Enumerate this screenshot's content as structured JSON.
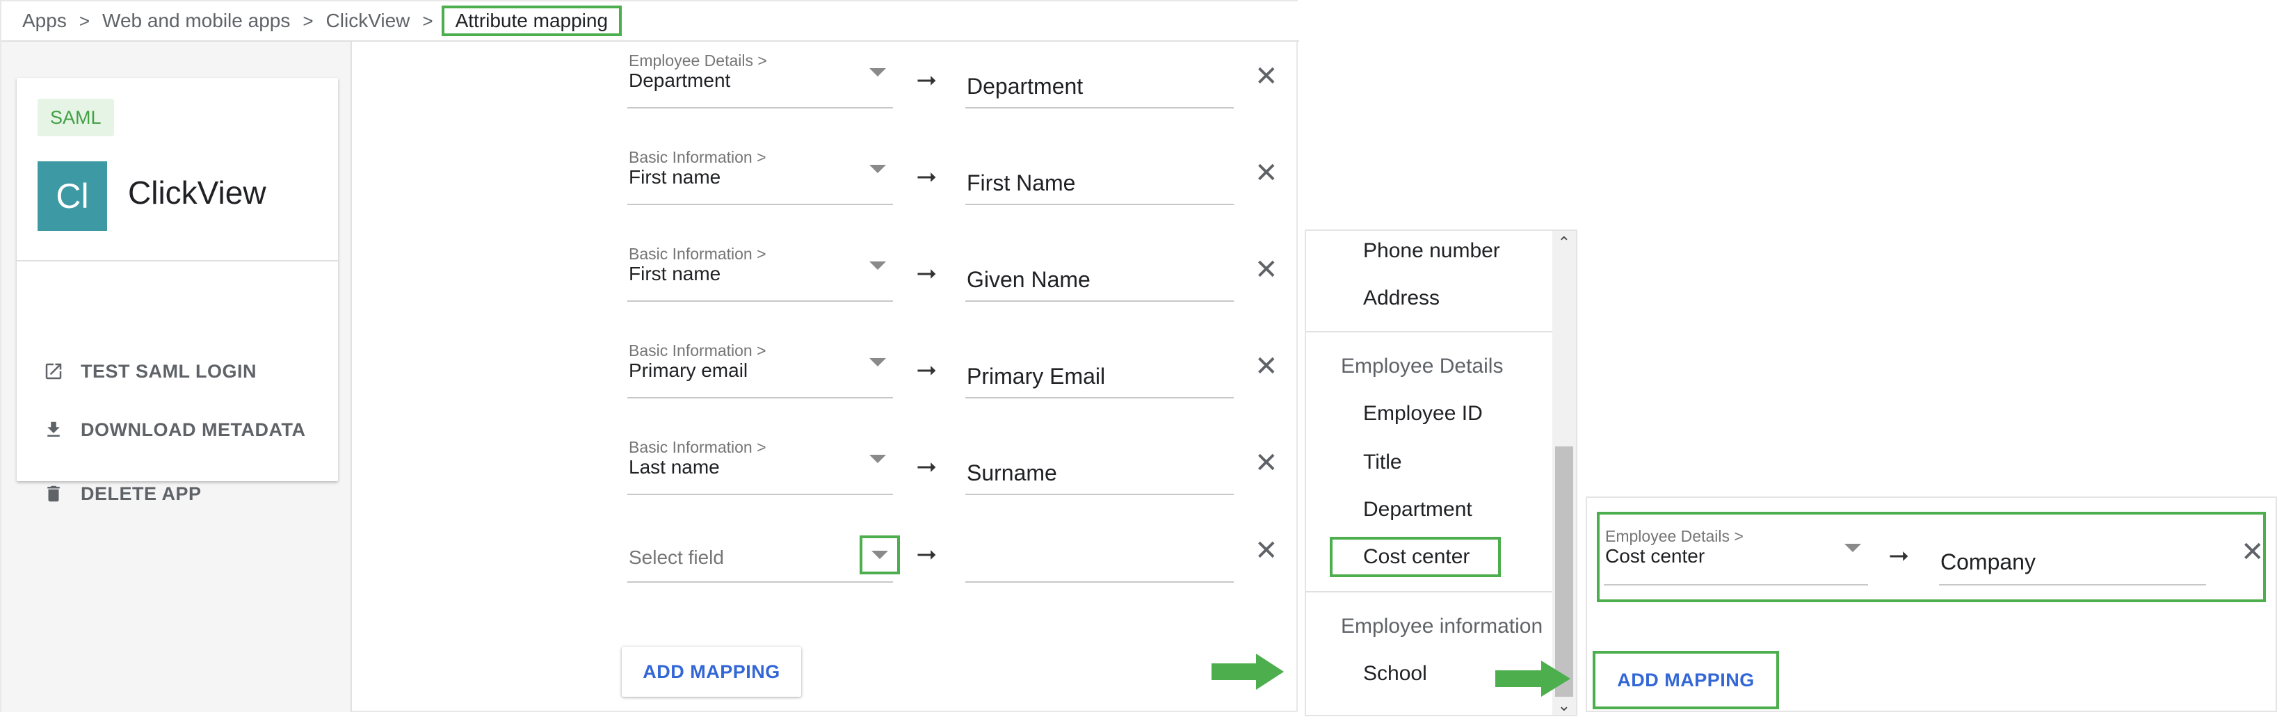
{
  "breadcrumb": {
    "items": [
      "Apps",
      "Web and mobile apps",
      "ClickView"
    ],
    "current": "Attribute mapping",
    "separator": ">"
  },
  "app_card": {
    "badge": "SAML",
    "avatar_initials": "Cl",
    "app_name": "ClickView",
    "actions": [
      {
        "label": "TEST SAML LOGIN",
        "icon": "open-external-icon"
      },
      {
        "label": "DOWNLOAD METADATA",
        "icon": "download-icon"
      },
      {
        "label": "DELETE APP",
        "icon": "trash-icon"
      }
    ]
  },
  "mappings": [
    {
      "category": "Employee Details >",
      "field": "Department",
      "target": "Department"
    },
    {
      "category": "Basic Information >",
      "field": "First name",
      "target": "First Name"
    },
    {
      "category": "Basic Information >",
      "field": "First name",
      "target": "Given Name"
    },
    {
      "category": "Basic Information >",
      "field": "Primary email",
      "target": "Primary Email"
    },
    {
      "category": "Basic Information >",
      "field": "Last name",
      "target": "Surname"
    }
  ],
  "empty_row": {
    "placeholder": "Select field",
    "target": ""
  },
  "symbols": {
    "arrow": "⭢",
    "close": "✕",
    "chevron_up": "⌃",
    "chevron_down": "⌄"
  },
  "add_mapping_label": "ADD MAPPING",
  "dropdown": {
    "options_top": [
      "Phone number",
      "Address"
    ],
    "group_employee_details": "Employee Details",
    "employee_details_options": [
      "Employee ID",
      "Title",
      "Department",
      "Cost center"
    ],
    "group_employee_information": "Employee information",
    "employee_information_options": [
      "School"
    ],
    "highlighted_option": "Cost center"
  },
  "result": {
    "category": "Employee Details >",
    "field": "Cost center",
    "target": "Company",
    "add_label": "ADD MAPPING"
  },
  "colors": {
    "highlight": "#4cae4c",
    "link_blue": "#3367d6",
    "avatar": "#3d9aa5",
    "badge_bg": "#e6f4e6",
    "badge_text": "#43a047"
  }
}
